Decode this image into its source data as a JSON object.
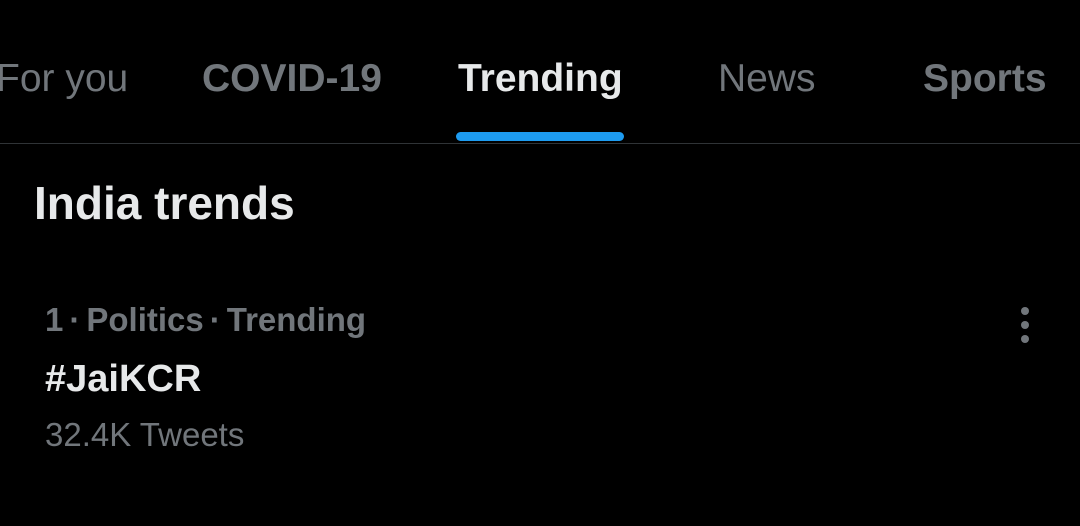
{
  "tabs": [
    {
      "label": "For you",
      "active": false
    },
    {
      "label": "COVID-19",
      "active": false
    },
    {
      "label": "Trending",
      "active": true
    },
    {
      "label": "News",
      "active": false
    },
    {
      "label": "Sports",
      "active": false
    }
  ],
  "section": {
    "title": "India trends"
  },
  "trends": [
    {
      "rank": "1",
      "category": "Politics",
      "status": "Trending",
      "name": "#JaiKCR",
      "count": "32.4K Tweets",
      "more_icon": "more-vertical-icon"
    }
  ],
  "separator": "·",
  "colors": {
    "background": "#000000",
    "primary_text": "#e7e9ea",
    "secondary_text": "#71767b",
    "accent": "#1d9bf0",
    "divider": "#2f3336"
  }
}
